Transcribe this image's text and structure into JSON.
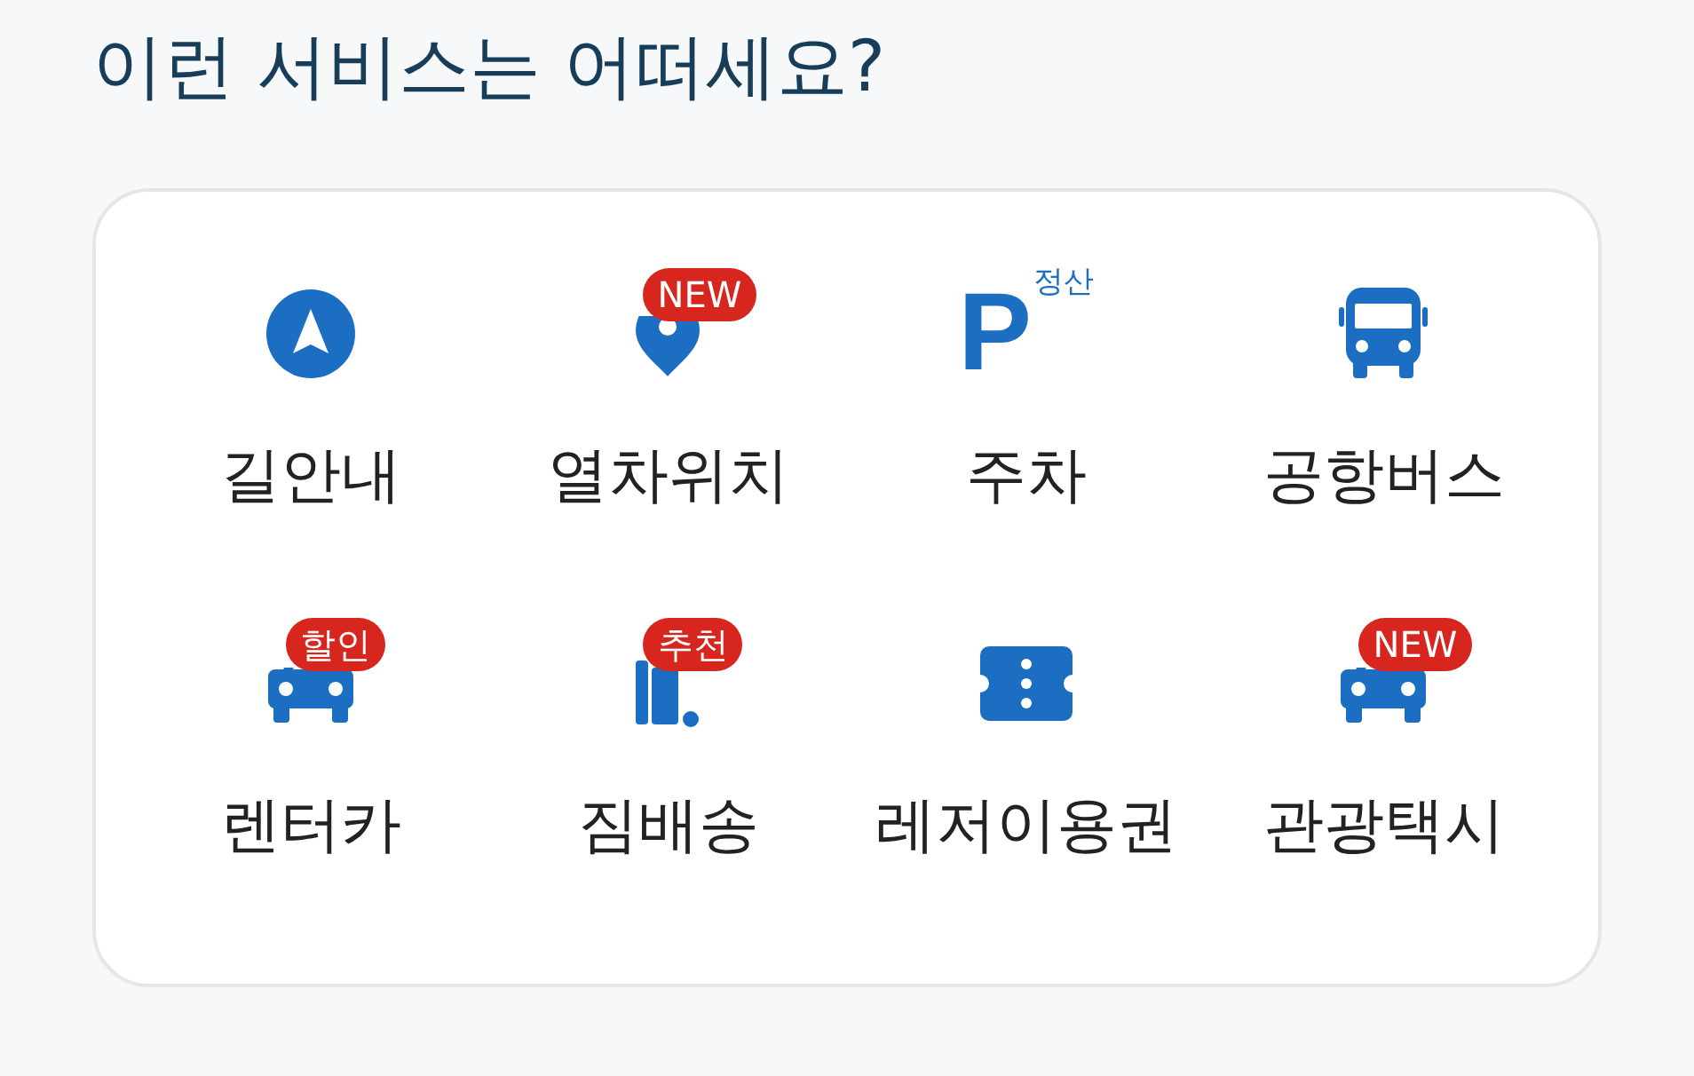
{
  "title": "이런 서비스는 어떠세요?",
  "services": [
    {
      "kind": "navigation",
      "label": "길안내"
    },
    {
      "kind": "pin",
      "label": "열차위치",
      "badge": "NEW"
    },
    {
      "kind": "parking",
      "label": "주차",
      "icon_text": "P",
      "superscript": "정산"
    },
    {
      "kind": "bus",
      "label": "공항버스"
    },
    {
      "kind": "car",
      "label": "렌터카",
      "badge": "할인"
    },
    {
      "kind": "luggage",
      "label": "짐배송",
      "badge": "추천"
    },
    {
      "kind": "ticket",
      "label": "레저이용권"
    },
    {
      "kind": "car",
      "label": "관광택시",
      "badge": "NEW"
    }
  ]
}
